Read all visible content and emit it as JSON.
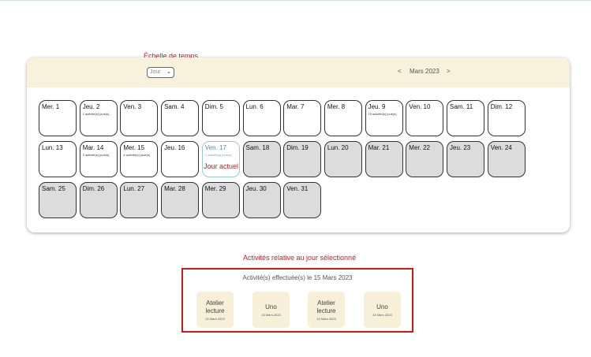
{
  "annotations": {
    "scale_label": "Échelle de temps",
    "today_label": "Jour actuel",
    "panel_label": "Activités relative au jour sélectionné"
  },
  "header": {
    "scale_value": "Jour",
    "month_label": "Mars 2023",
    "prev": "<",
    "next": ">"
  },
  "calendar": {
    "days": [
      {
        "label": "Mer. 1",
        "activity": ""
      },
      {
        "label": "Jeu. 2",
        "activity": "1 activité(s) joué(s)"
      },
      {
        "label": "Ven. 3",
        "activity": ""
      },
      {
        "label": "Sam. 4",
        "activity": ""
      },
      {
        "label": "Dim. 5",
        "activity": ""
      },
      {
        "label": "Lun. 6",
        "activity": ""
      },
      {
        "label": "Mar. 7",
        "activity": ""
      },
      {
        "label": "Mer. 8",
        "activity": ""
      },
      {
        "label": "Jeu. 9",
        "activity": "15 activité(s) joué(s)"
      },
      {
        "label": "Ven. 10",
        "activity": ""
      },
      {
        "label": "Sam. 11",
        "activity": ""
      },
      {
        "label": "Dim. 12",
        "activity": ""
      },
      {
        "label": "Lun. 13",
        "activity": ""
      },
      {
        "label": "Mar. 14",
        "activity": "2 activité(s) joué(s)"
      },
      {
        "label": "Mer. 15",
        "activity": "4 activité(s) joué(s)"
      },
      {
        "label": "Jeu. 16",
        "activity": ""
      },
      {
        "label": "Ven. 17",
        "activity": "1 activité(s) joué(s)",
        "today": true
      },
      {
        "label": "Sam. 18",
        "activity": "",
        "future": true
      },
      {
        "label": "Dim. 19",
        "activity": "",
        "future": true
      },
      {
        "label": "Lun. 20",
        "activity": "",
        "future": true
      },
      {
        "label": "Mar. 21",
        "activity": "",
        "future": true
      },
      {
        "label": "Mer. 22",
        "activity": "",
        "future": true
      },
      {
        "label": "Jeu. 23",
        "activity": "",
        "future": true
      },
      {
        "label": "Ven. 24",
        "activity": "",
        "future": true
      },
      {
        "label": "Sam. 25",
        "activity": "",
        "future": true
      },
      {
        "label": "Dim. 26",
        "activity": "",
        "future": true
      },
      {
        "label": "Lun. 27",
        "activity": "",
        "future": true
      },
      {
        "label": "Mar. 28",
        "activity": "",
        "future": true
      },
      {
        "label": "Mer. 29",
        "activity": "",
        "future": true
      },
      {
        "label": "Jeu. 30",
        "activity": "",
        "future": true
      },
      {
        "label": "Ven. 31",
        "activity": "",
        "future": true
      }
    ]
  },
  "activities_panel": {
    "title": "Activité(s) effectuée(s) le 15 Mars 2023",
    "items": [
      {
        "name": "Atelier lecture",
        "date": "15 Mars 2023"
      },
      {
        "name": "Uno",
        "date": "15 Mars 2023"
      },
      {
        "name": "Atelier lecture",
        "date": "15 Mars 2023"
      },
      {
        "name": "Uno",
        "date": "15 Mars 2023"
      }
    ]
  },
  "colors": {
    "annotation_red": "#d01818",
    "header_bg": "#f8f1dc",
    "future_day_bg": "#dcdcdc",
    "today_text": "#4a8f9a",
    "activity_card_bg": "#f8efd8"
  }
}
